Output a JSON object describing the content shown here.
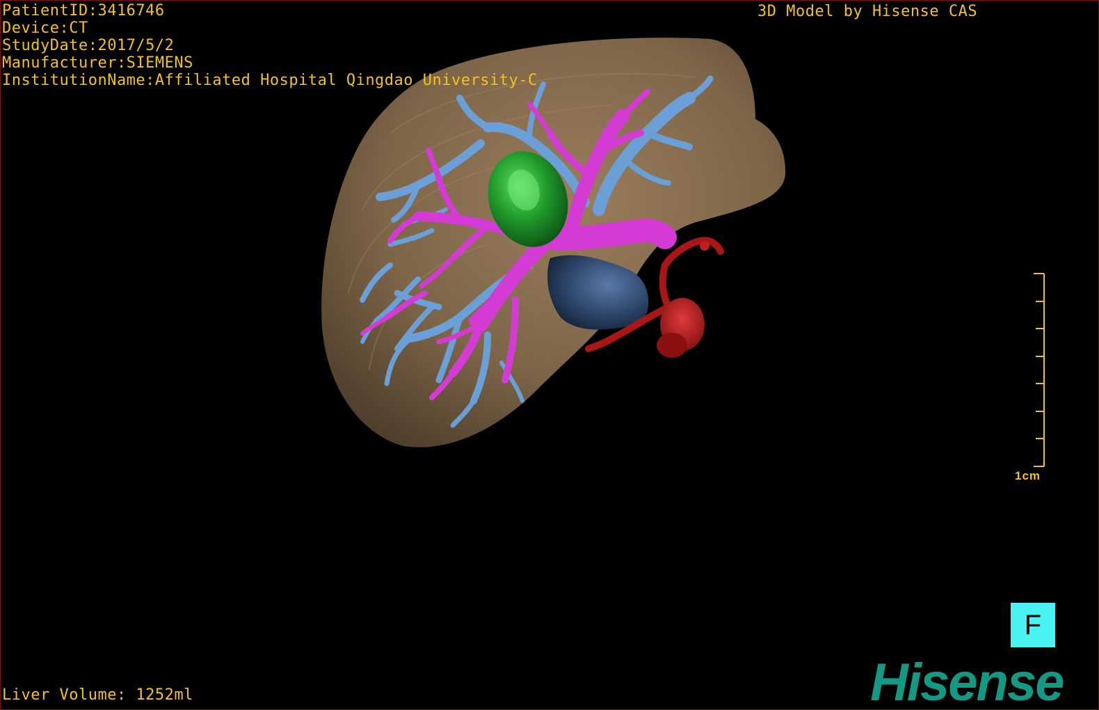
{
  "overlay": {
    "patient_id": "PatientID:3416746",
    "device": "Device:CT",
    "study_date": "StudyDate:2017/5/2",
    "manufacturer": "Manufacturer:SIEMENS",
    "institution": "InstitutionName:Affiliated Hospital Qingdao University-C",
    "model_credit": "3D Model by Hisense CAS",
    "liver_volume": "Liver Volume: 1252ml"
  },
  "scale_bar": {
    "label": "1cm"
  },
  "orientation_button": {
    "label": "F"
  },
  "logo": {
    "text": "Hisense"
  },
  "colors": {
    "overlay_text": "#f2c21f",
    "liver": "#7d6548",
    "portal_vein": "#d43bd4",
    "hepatic_vein": "#6a9fd8",
    "tumor": "#1f9a2a",
    "gallbladder": "#2c4468",
    "artery": "#b01818",
    "orientation_button": "#4bf2f2",
    "logo": "#149a84",
    "border": "#7a1010"
  },
  "model_parts": [
    "liver-model",
    "hepatic-vein-tree",
    "portal-vein-tree",
    "tumor-model",
    "gallbladder-model",
    "artery-model"
  ]
}
